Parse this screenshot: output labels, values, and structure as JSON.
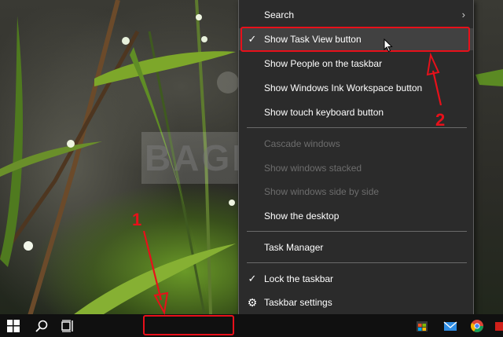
{
  "watermark": {
    "text": "BAGITEKNO"
  },
  "context_menu": {
    "items": [
      {
        "label": "Search",
        "checked": false,
        "disabled": false,
        "submenu": true
      },
      {
        "label": "Show Task View button",
        "checked": true,
        "disabled": false,
        "highlighted": true
      },
      {
        "label": "Show People on the taskbar",
        "checked": false,
        "disabled": false
      },
      {
        "label": "Show Windows Ink Workspace button",
        "checked": false,
        "disabled": false
      },
      {
        "label": "Show touch keyboard button",
        "checked": false,
        "disabled": false
      },
      {
        "label": "Cascade windows",
        "checked": false,
        "disabled": true
      },
      {
        "label": "Show windows stacked",
        "checked": false,
        "disabled": true
      },
      {
        "label": "Show windows side by side",
        "checked": false,
        "disabled": true
      },
      {
        "label": "Show the desktop",
        "checked": false,
        "disabled": false
      },
      {
        "label": "Task Manager",
        "checked": false,
        "disabled": false
      },
      {
        "label": "Lock the taskbar",
        "checked": true,
        "disabled": false
      },
      {
        "label": "Taskbar settings",
        "checked": false,
        "disabled": false,
        "icon": "gear-icon"
      }
    ],
    "check_glyph": "✓",
    "chevron_glyph": "›",
    "gear_glyph": "⚙"
  },
  "taskbar": {
    "left_icons": [
      "windows-start-icon",
      "search-icon",
      "task-view-icon"
    ],
    "tray_icons": [
      "store-icon",
      "mail-icon",
      "chrome-icon",
      "app-icon"
    ]
  },
  "annotations": [
    {
      "number": "1",
      "target": "taskbar-empty-area"
    },
    {
      "number": "2",
      "target": "show-task-view-button-menu-item"
    }
  ],
  "colors": {
    "annotation": "#e8101a",
    "menu_background": "#2b2b2b",
    "menu_highlight": "#414141",
    "taskbar": "#101010"
  }
}
